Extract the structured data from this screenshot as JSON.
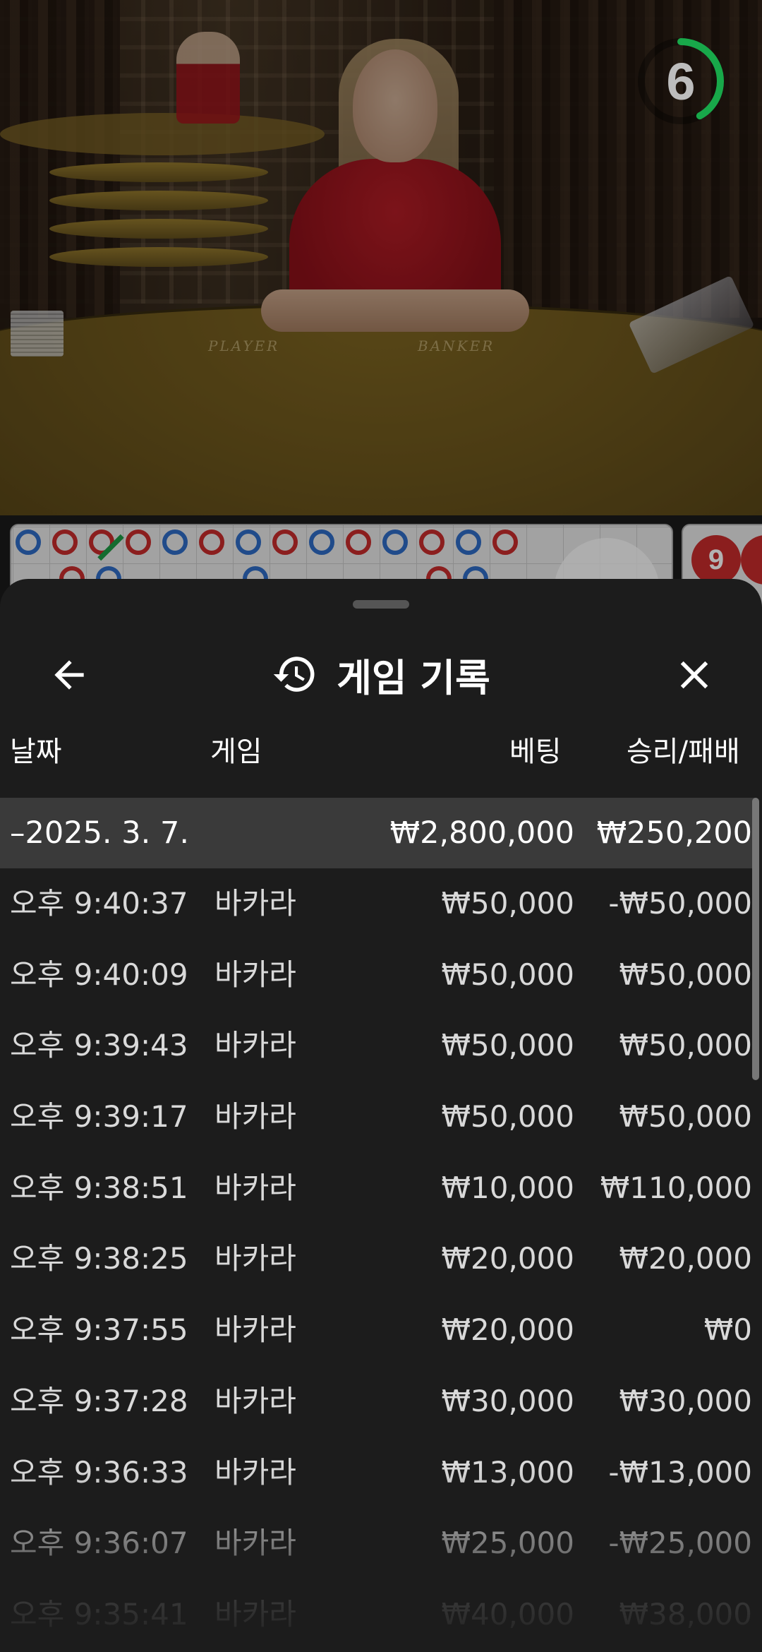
{
  "video": {
    "table_labels": {
      "player": "PLAYER",
      "banker": "BANKER"
    },
    "countdown": {
      "value": "6",
      "ring_color": "#18a84a",
      "progress": 0.42
    }
  },
  "roadmap": {
    "side_badge": "9",
    "top_row": [
      "b",
      "r",
      "r",
      "r",
      "b",
      "r",
      "b",
      "r",
      "b",
      "r",
      "b",
      "r",
      "b",
      "r"
    ],
    "colors": {
      "banker": "#c72b2b",
      "player": "#2f6cc6",
      "tie": "#1d9b45"
    }
  },
  "history": {
    "title": "게임 기록",
    "icons": {
      "back": "arrow-left-icon",
      "history": "history-clock-icon",
      "close": "close-x-icon"
    },
    "columns": {
      "date": "날짜",
      "game": "게임",
      "bet": "베팅",
      "result": "승리/패배"
    },
    "group": {
      "date": "–2025. 3. 7.",
      "bet_total": "₩2,800,000",
      "result_total": "₩250,200"
    },
    "rows": [
      {
        "time": "오후 9:40:37",
        "game": "바카라",
        "bet": "₩50,000",
        "result": "-₩50,000"
      },
      {
        "time": "오후 9:40:09",
        "game": "바카라",
        "bet": "₩50,000",
        "result": "₩50,000"
      },
      {
        "time": "오후 9:39:43",
        "game": "바카라",
        "bet": "₩50,000",
        "result": "₩50,000"
      },
      {
        "time": "오후 9:39:17",
        "game": "바카라",
        "bet": "₩50,000",
        "result": "₩50,000"
      },
      {
        "time": "오후 9:38:51",
        "game": "바카라",
        "bet": "₩10,000",
        "result": "₩110,000"
      },
      {
        "time": "오후 9:38:25",
        "game": "바카라",
        "bet": "₩20,000",
        "result": "₩20,000"
      },
      {
        "time": "오후 9:37:55",
        "game": "바카라",
        "bet": "₩20,000",
        "result": "₩0"
      },
      {
        "time": "오후 9:37:28",
        "game": "바카라",
        "bet": "₩30,000",
        "result": "₩30,000"
      },
      {
        "time": "오후 9:36:33",
        "game": "바카라",
        "bet": "₩13,000",
        "result": "-₩13,000"
      },
      {
        "time": "오후 9:36:07",
        "game": "바카라",
        "bet": "₩25,000",
        "result": "-₩25,000"
      },
      {
        "time": "오후 9:35:41",
        "game": "바카라",
        "bet": "₩40,000",
        "result": "₩38,000"
      }
    ]
  }
}
